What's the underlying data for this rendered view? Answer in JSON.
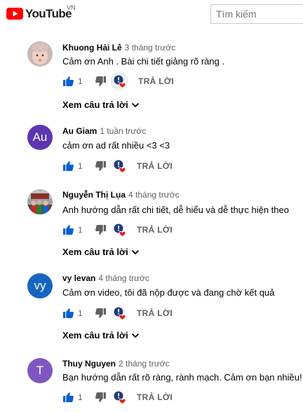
{
  "header": {
    "logo_text": "YouTube",
    "country": "VN",
    "search_placeholder": "Tìm kiếm"
  },
  "colors": {
    "brand_red": "#ff0000",
    "like_blue": "#065fd4",
    "heart_red": "#e62117",
    "avatar_au": "#5e35b1",
    "avatar_vy": "#1565c0",
    "avatar_t": "#7e57c2"
  },
  "comments": [
    {
      "author": "Khuong Hải Lê",
      "time": "3 tháng trước",
      "text": "Cảm ơn Anh . Bài chi tiết  giảng rõ ràng .",
      "likes": "1",
      "reply_label": "TRẢ LỜI",
      "view_replies": "Xem câu trả lời",
      "avatar_icon": "baby-photo-avatar"
    },
    {
      "author": "Au Giam",
      "time": "1 tuần trước",
      "text": "cảm ơn ad rất nhiều <3 <3",
      "likes": "1",
      "reply_label": "TRẢ LỜI",
      "avatar_letters": "Au"
    },
    {
      "author": "Nguyễn Thị Lụa",
      "time": "4 tháng trước",
      "text": "Anh hướng dẫn rất chi tiết, dễ hiểu và dễ thực hiện theo",
      "likes": "1",
      "reply_label": "TRẢ LỜI",
      "view_replies": "Xem câu trả lời",
      "avatar_icon": "group-photo-avatar"
    },
    {
      "author": "vy levan",
      "time": "4 tháng trước",
      "text": "Cảm ơn video, tôi đã nộp được và đang chờ kết quả",
      "likes": "1",
      "reply_label": "TRẢ LỜI",
      "view_replies": "Xem câu trả lời",
      "avatar_letters": "vy"
    },
    {
      "author": "Thuy Nguyen",
      "time": "2 tháng trước",
      "text": "Bạn hướng dẫn rất rõ ràng, rành mạch. Cảm ơn bạn nhiều!",
      "likes": "1",
      "reply_label": "TRẢ LỜI",
      "avatar_letters": "T"
    }
  ]
}
